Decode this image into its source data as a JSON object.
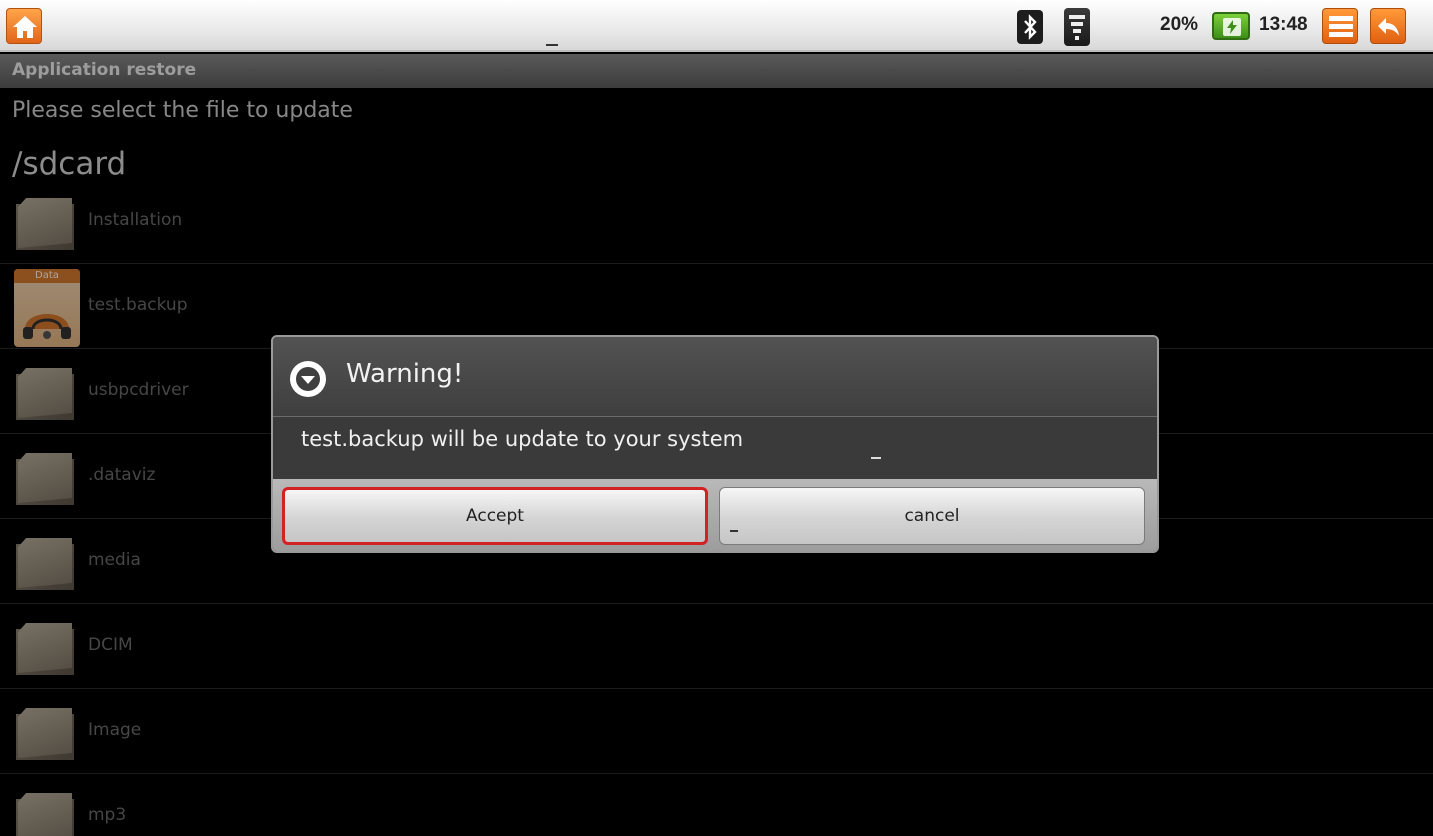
{
  "status_bar": {
    "battery_percent": "20%",
    "time": "13:48",
    "icons": [
      "home-icon",
      "bluetooth-icon",
      "wifi-icon",
      "battery-charging-icon",
      "menu-icon",
      "back-icon"
    ],
    "accent_color": "#e8701e"
  },
  "app": {
    "title": "Application restore",
    "instruction": "Please select the file to update",
    "current_path": "/sdcard"
  },
  "files": [
    {
      "name": "Installation",
      "icon": "folder-icon"
    },
    {
      "name": "test.backup",
      "icon": "data-file-icon",
      "tag": "Data"
    },
    {
      "name": "usbpcdriver",
      "icon": "folder-icon"
    },
    {
      "name": ".dataviz",
      "icon": "folder-icon"
    },
    {
      "name": "media",
      "icon": "folder-icon"
    },
    {
      "name": "DCIM",
      "icon": "folder-icon"
    },
    {
      "name": "Image",
      "icon": "folder-icon"
    },
    {
      "name": "mp3",
      "icon": "folder-icon"
    }
  ],
  "dialog": {
    "title": "Warning!",
    "message": "test.backup will be update to your system",
    "accept_label": "Accept",
    "cancel_label": "cancel",
    "highlight_color": "#d22323"
  }
}
